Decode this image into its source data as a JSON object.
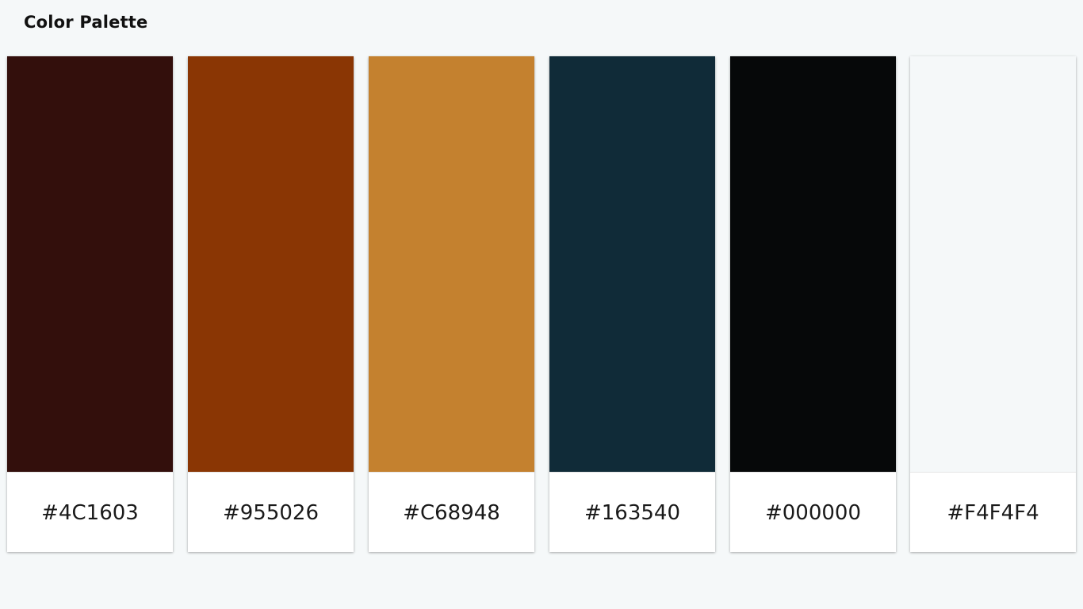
{
  "header": {
    "title": "Color Palette"
  },
  "palette": {
    "colors": [
      {
        "code": "#4C1603",
        "swatch": "#330f0c"
      },
      {
        "code": "#955026",
        "swatch": "#8a3604"
      },
      {
        "code": "#C68948",
        "swatch": "#c4812f"
      },
      {
        "code": "#163540",
        "swatch": "#102b38"
      },
      {
        "code": "#000000",
        "swatch": "#060809"
      },
      {
        "code": "#F4F4F4",
        "swatch": "#f5f8f9"
      }
    ]
  }
}
